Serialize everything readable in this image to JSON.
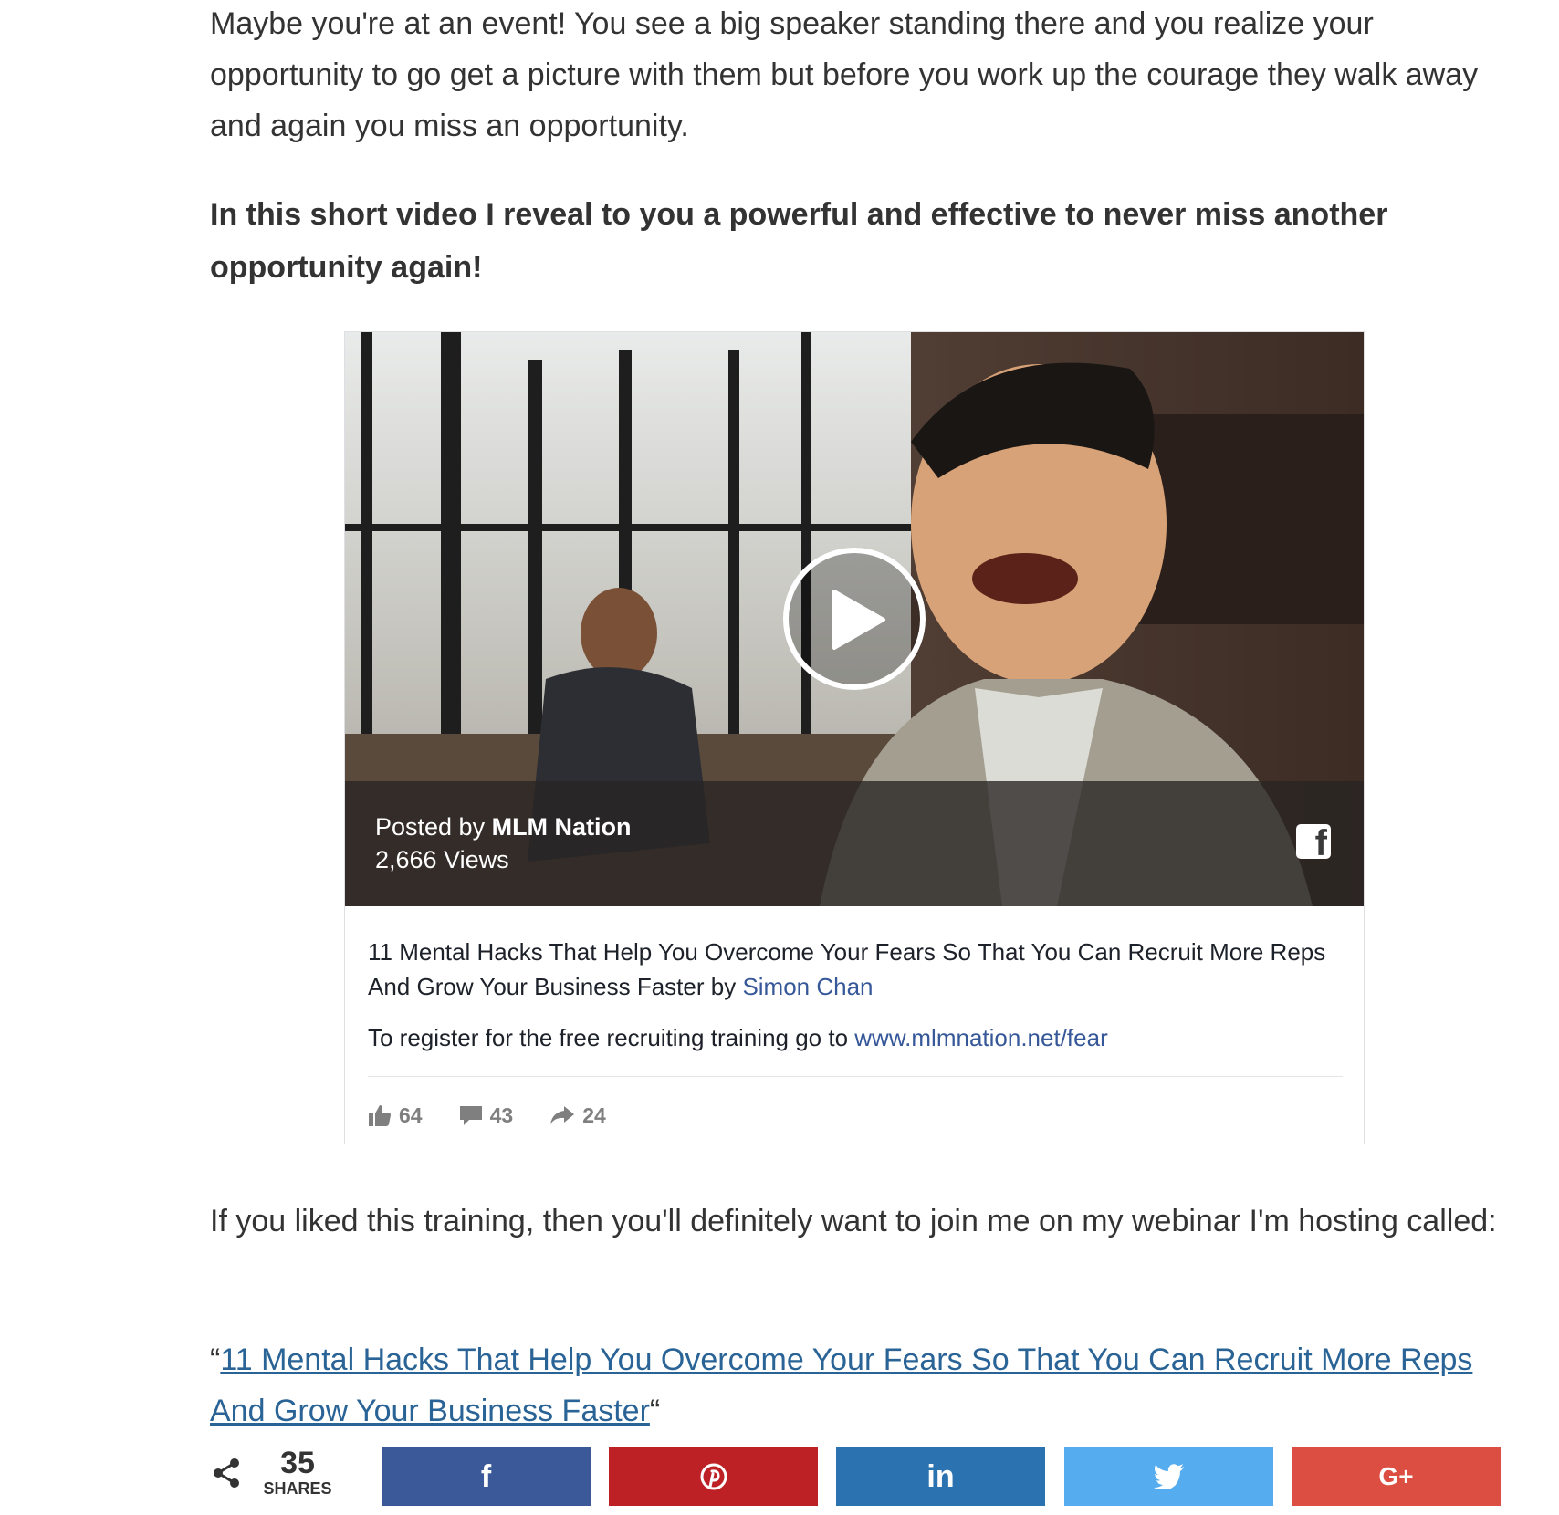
{
  "article": {
    "paragraph1": "Maybe you're at an event! You see a big speaker standing there and you realize your opportunity to go get a picture with them but before you work up the courage they walk away and again you miss an opportunity.",
    "paragraph2": "In this short video I reveal to you a powerful and effective to never miss another opportunity again!",
    "paragraph3": "If you liked this training, then you'll definitely want to join me on my webinar I'm hosting called:",
    "quote_open": "“",
    "webinar_link": "11 Mental Hacks That Help You Overcome Your Fears So That You Can Recruit More Reps And Grow Your Business Faster",
    "quote_close": "“"
  },
  "video": {
    "posted_prefix": "Posted by ",
    "page_name": "MLM Nation",
    "views": "2,666 Views",
    "fb_glyph": "f",
    "caption_text": "11 Mental Hacks That Help You Overcome Your Fears So That You Can Recruit More Reps And Grow Your Business Faster by ",
    "caption_author": "Simon Chan",
    "register_text": "To register for the free recruiting training go to ",
    "register_link": "www.mlmnation.net/fear",
    "likes": "64",
    "comments": "43",
    "shares": "24"
  },
  "sharebar": {
    "count": "35",
    "count_label": "SHARES",
    "facebook": "f",
    "pinterest": "pinterest-icon",
    "linkedin": "in",
    "twitter": "twitter-icon",
    "googleplus": "G+",
    "colors": {
      "facebook": "#3b5998",
      "pinterest": "#bd2126",
      "linkedin": "#2a72b0",
      "twitter": "#55acee",
      "googleplus": "#dc4e41"
    }
  }
}
